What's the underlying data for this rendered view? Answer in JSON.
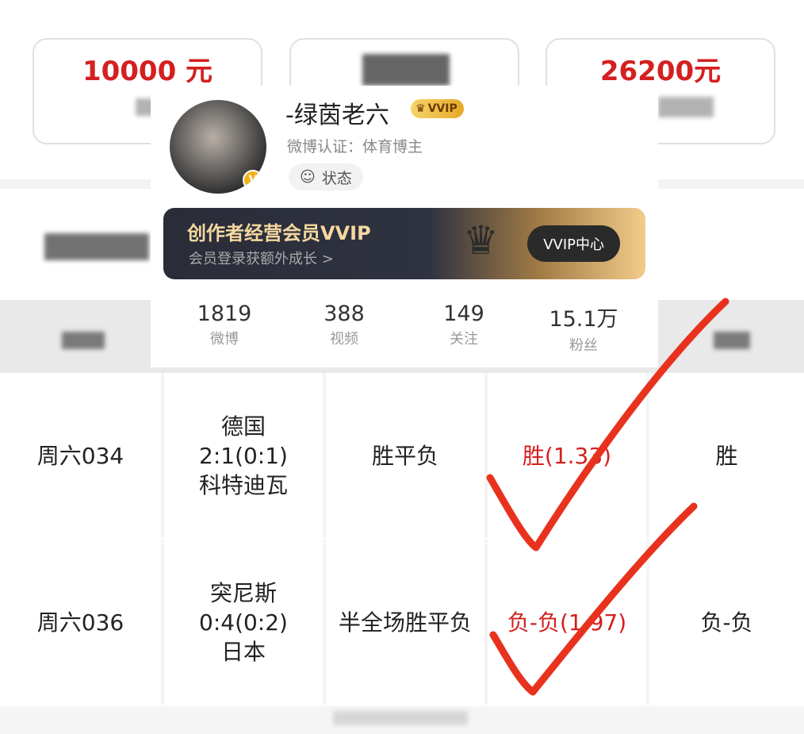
{
  "cards": [
    {
      "amount": "10000 元"
    },
    {
      "amount": ""
    },
    {
      "amount": "26200元"
    }
  ],
  "profile": {
    "nickname": "-绿茵老六",
    "badge": "VVIP",
    "verification": "微博认证：体育博主",
    "status_label": "状态",
    "banner_title": "创作者经营会员VVIP",
    "banner_subtitle": "会员登录获额外成长 >",
    "banner_button": "VVIP中心",
    "stats": [
      {
        "value": "1819",
        "label": "微博"
      },
      {
        "value": "388",
        "label": "视频"
      },
      {
        "value": "149",
        "label": "关注"
      },
      {
        "value": "15.1万",
        "label": "粉丝"
      }
    ]
  },
  "table": {
    "rows": [
      {
        "id": "周六034",
        "home": "德国",
        "score": "2:1(0:1)",
        "away": "科特迪瓦",
        "play": "胜平负",
        "pick": "胜(1.33)",
        "result": "胜"
      },
      {
        "id": "周六036",
        "home": "突尼斯",
        "score": "0:4(0:2)",
        "away": "日本",
        "play": "半全场胜平负",
        "pick": "负-负(1.97)",
        "result": "负-负"
      }
    ]
  },
  "colors": {
    "accent_red": "#d42020",
    "checkmark": "#e8321e"
  }
}
